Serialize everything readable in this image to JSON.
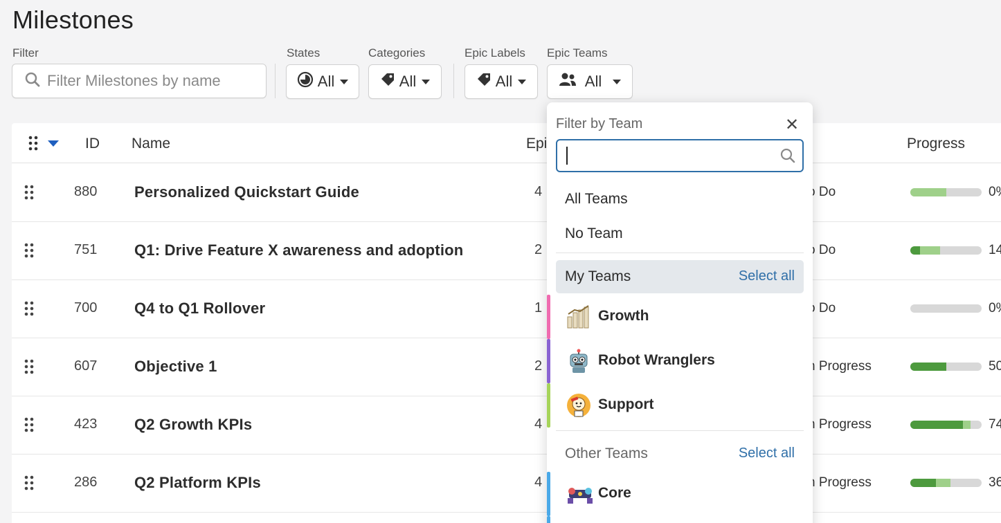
{
  "page": {
    "title": "Milestones"
  },
  "filters": {
    "filter_label": "Filter",
    "search_placeholder": "Filter Milestones by name",
    "states": {
      "label": "States",
      "value": "All"
    },
    "categories": {
      "label": "Categories",
      "value": "All"
    },
    "epic_labels": {
      "label": "Epic Labels",
      "value": "All"
    },
    "epic_teams": {
      "label": "Epic Teams",
      "value": "All"
    }
  },
  "table": {
    "headers": {
      "id": "ID",
      "name": "Name",
      "epics": "Epi",
      "progress": "Progress"
    },
    "rows": [
      {
        "id": "880",
        "name": "Personalized Quickstart Guide",
        "epics": "4",
        "state": "o Do",
        "pct": "0%",
        "done": 0.0,
        "started": 0.5
      },
      {
        "id": "751",
        "name": "Q1: Drive Feature X awareness and adoption",
        "epics": "2",
        "state": "o Do",
        "pct": "14",
        "done": 0.14,
        "started": 0.28
      },
      {
        "id": "700",
        "name": "Q4 to Q1 Rollover",
        "epics": "1",
        "state": "o Do",
        "pct": "0%",
        "done": 0.0,
        "started": 0.0
      },
      {
        "id": "607",
        "name": "Objective 1",
        "epics": "2",
        "state": "n Progress",
        "pct": "50",
        "done": 0.5,
        "started": 0.0
      },
      {
        "id": "423",
        "name": "Q2 Growth KPIs",
        "epics": "4",
        "state": "n Progress",
        "pct": "74",
        "done": 0.74,
        "started": 0.1
      },
      {
        "id": "286",
        "name": "Q2 Platform KPIs",
        "epics": "4",
        "state": "n Progress",
        "pct": "36",
        "done": 0.36,
        "started": 0.2
      }
    ]
  },
  "team_dropdown": {
    "title": "Filter by Team",
    "close_glyph": "✕",
    "search_value": "",
    "all_teams": "All Teams",
    "no_team": "No Team",
    "my_teams": {
      "label": "My Teams",
      "select_all": "Select all"
    },
    "other_teams": {
      "label": "Other Teams",
      "select_all": "Select all"
    },
    "my_team_items": [
      {
        "name": "Growth",
        "color": "#f06bb0",
        "icon": "growth-chart-icon"
      },
      {
        "name": "Robot Wranglers",
        "color": "#8a63d2",
        "icon": "robot-icon"
      },
      {
        "name": "Support",
        "color": "#a6d45a",
        "icon": "support-mascot-icon"
      }
    ],
    "other_team_items": [
      {
        "name": "Core",
        "color": "#4aa9e8",
        "icon": "core-team-icon"
      }
    ]
  },
  "colors": {
    "accent": "#2f6fa8",
    "progress_done": "#4d9a3e",
    "progress_started": "#9fd08a"
  }
}
